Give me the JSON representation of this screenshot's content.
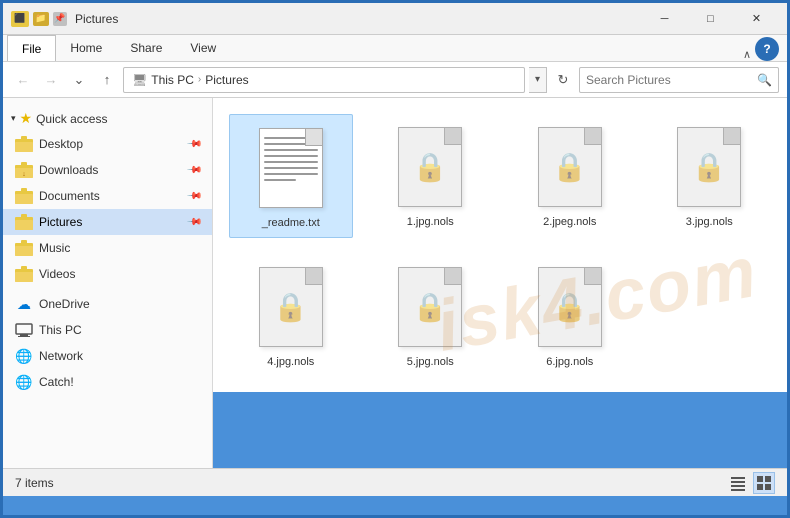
{
  "titleBar": {
    "title": "Pictures",
    "minimize": "─",
    "maximize": "□",
    "close": "✕"
  },
  "ribbon": {
    "tabs": [
      "File",
      "Home",
      "Share",
      "View"
    ],
    "activeTab": "File",
    "helpLabel": "?"
  },
  "addressBar": {
    "path": [
      "This PC",
      "Pictures"
    ],
    "searchPlaceholder": "Search Pictures"
  },
  "sidebar": {
    "quickAccessLabel": "Quick access",
    "items": [
      {
        "label": "Desktop",
        "pinned": true
      },
      {
        "label": "Downloads",
        "pinned": true
      },
      {
        "label": "Documents",
        "pinned": true
      },
      {
        "label": "Pictures",
        "pinned": true,
        "active": true
      },
      {
        "label": "Music"
      },
      {
        "label": "Videos"
      }
    ],
    "sections": [
      {
        "label": "OneDrive"
      },
      {
        "label": "This PC"
      },
      {
        "label": "Network"
      },
      {
        "label": "Catch!"
      }
    ]
  },
  "files": [
    {
      "name": "_readme.txt",
      "type": "txt",
      "selected": true
    },
    {
      "name": "1.jpg.nols",
      "type": "enc"
    },
    {
      "name": "2.jpeg.nols",
      "type": "enc"
    },
    {
      "name": "3.jpg.nols",
      "type": "enc"
    },
    {
      "name": "4.jpg.nols",
      "type": "enc"
    },
    {
      "name": "5.jpg.nols",
      "type": "enc"
    },
    {
      "name": "6.jpg.nols",
      "type": "enc"
    }
  ],
  "statusBar": {
    "count": "7 items"
  },
  "watermark": "isk4.com"
}
